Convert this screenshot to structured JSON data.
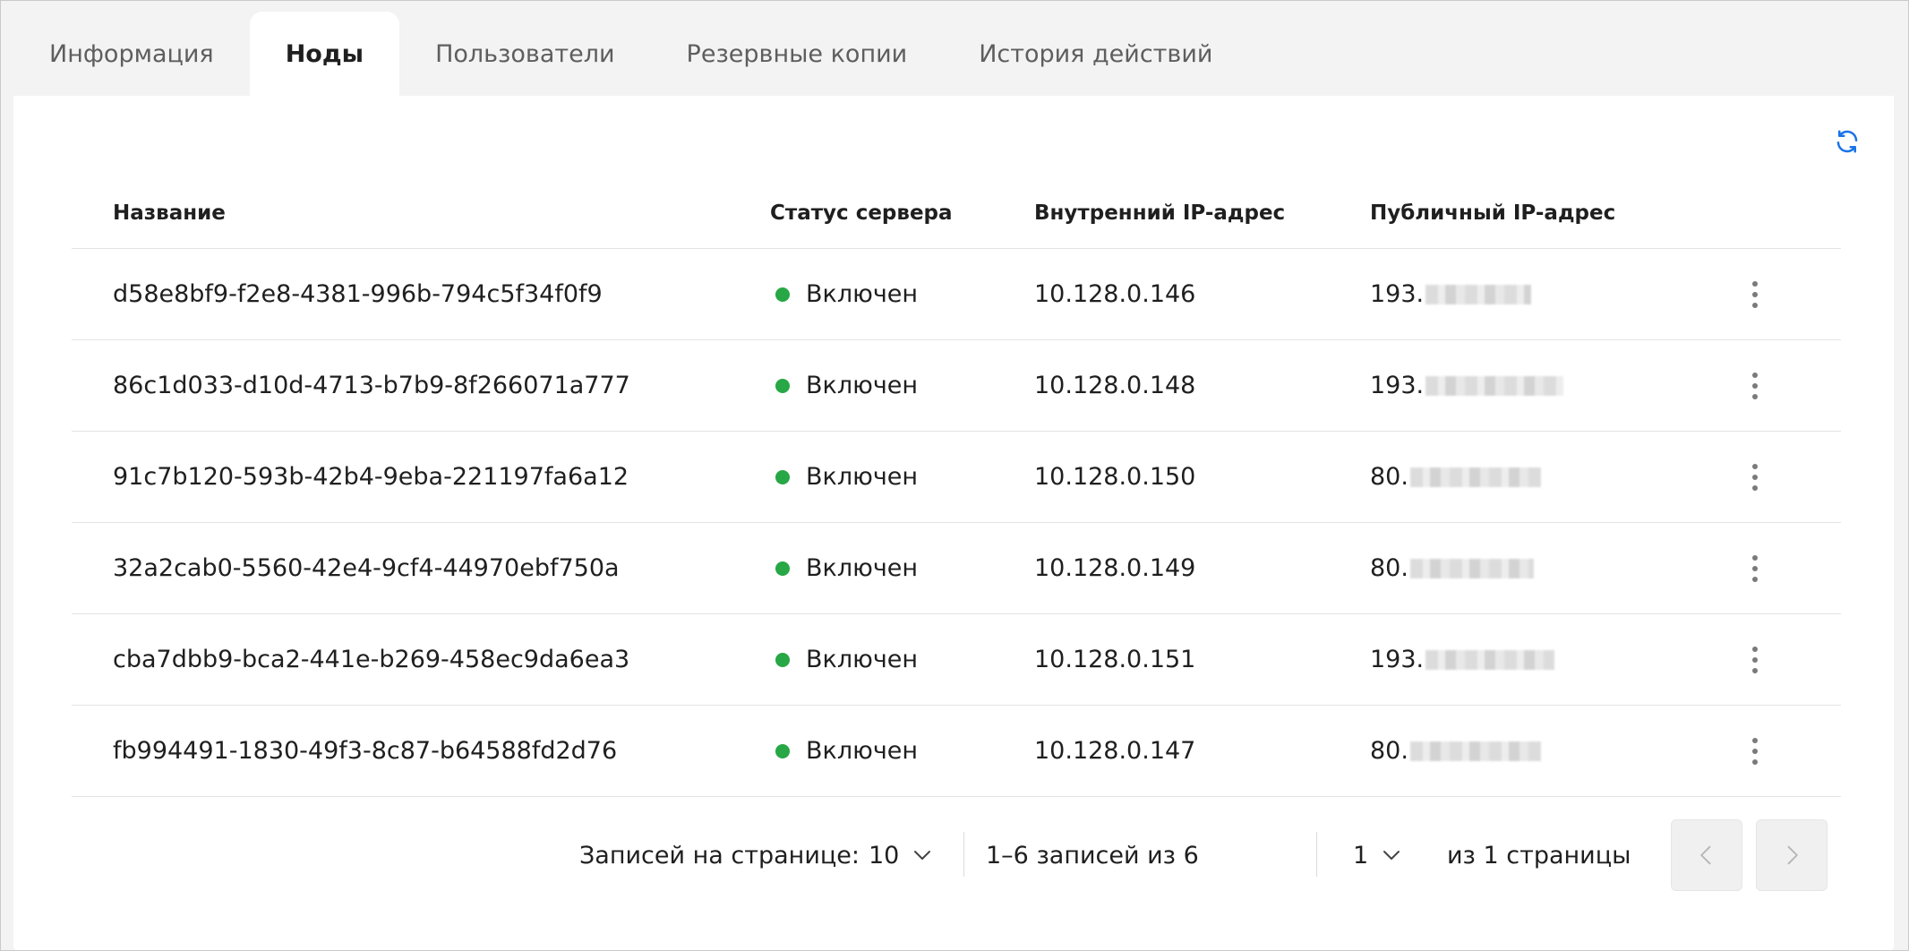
{
  "tabs": [
    {
      "label": "Информация",
      "active": false
    },
    {
      "label": "Ноды",
      "active": true
    },
    {
      "label": "Пользователи",
      "active": false
    },
    {
      "label": "Резервные копии",
      "active": false
    },
    {
      "label": "История действий",
      "active": false
    }
  ],
  "icons": {
    "refresh": "refresh-icon",
    "row_menu": "kebab-menu-icon",
    "status": "status-dot-icon",
    "dropdown": "chevron-down-icon",
    "prev": "chevron-left-icon",
    "next": "chevron-right-icon"
  },
  "colors": {
    "accent": "#1a73e8",
    "status_on": "#27a745",
    "background": "#f3f3f3",
    "panel": "#ffffff"
  },
  "table": {
    "columns": [
      "Название",
      "Статус сервера",
      "Внутренний IP-адрес",
      "Публичный IP-адрес"
    ],
    "rows": [
      {
        "name": "d58e8bf9-f2e8-4381-996b-794c5f34f0f9",
        "status": "Включен",
        "internal_ip": "10.128.0.146",
        "public_ip_prefix": "193."
      },
      {
        "name": "86c1d033-d10d-4713-b7b9-8f266071a777",
        "status": "Включен",
        "internal_ip": "10.128.0.148",
        "public_ip_prefix": "193."
      },
      {
        "name": "91c7b120-593b-42b4-9eba-221197fa6a12",
        "status": "Включен",
        "internal_ip": "10.128.0.150",
        "public_ip_prefix": "80."
      },
      {
        "name": "32a2cab0-5560-42e4-9cf4-44970ebf750a",
        "status": "Включен",
        "internal_ip": "10.128.0.149",
        "public_ip_prefix": "80."
      },
      {
        "name": "cba7dbb9-bca2-441e-b269-458ec9da6ea3",
        "status": "Включен",
        "internal_ip": "10.128.0.151",
        "public_ip_prefix": "193."
      },
      {
        "name": "fb994491-1830-49f3-8c87-b64588fd2d76",
        "status": "Включен",
        "internal_ip": "10.128.0.147",
        "public_ip_prefix": "80."
      }
    ]
  },
  "pagination": {
    "per_page_label": "Записей на странице:",
    "per_page_value": "10",
    "range_text": "1–6 записей из 6",
    "page_value": "1",
    "pages_text": "из 1 страницы"
  }
}
